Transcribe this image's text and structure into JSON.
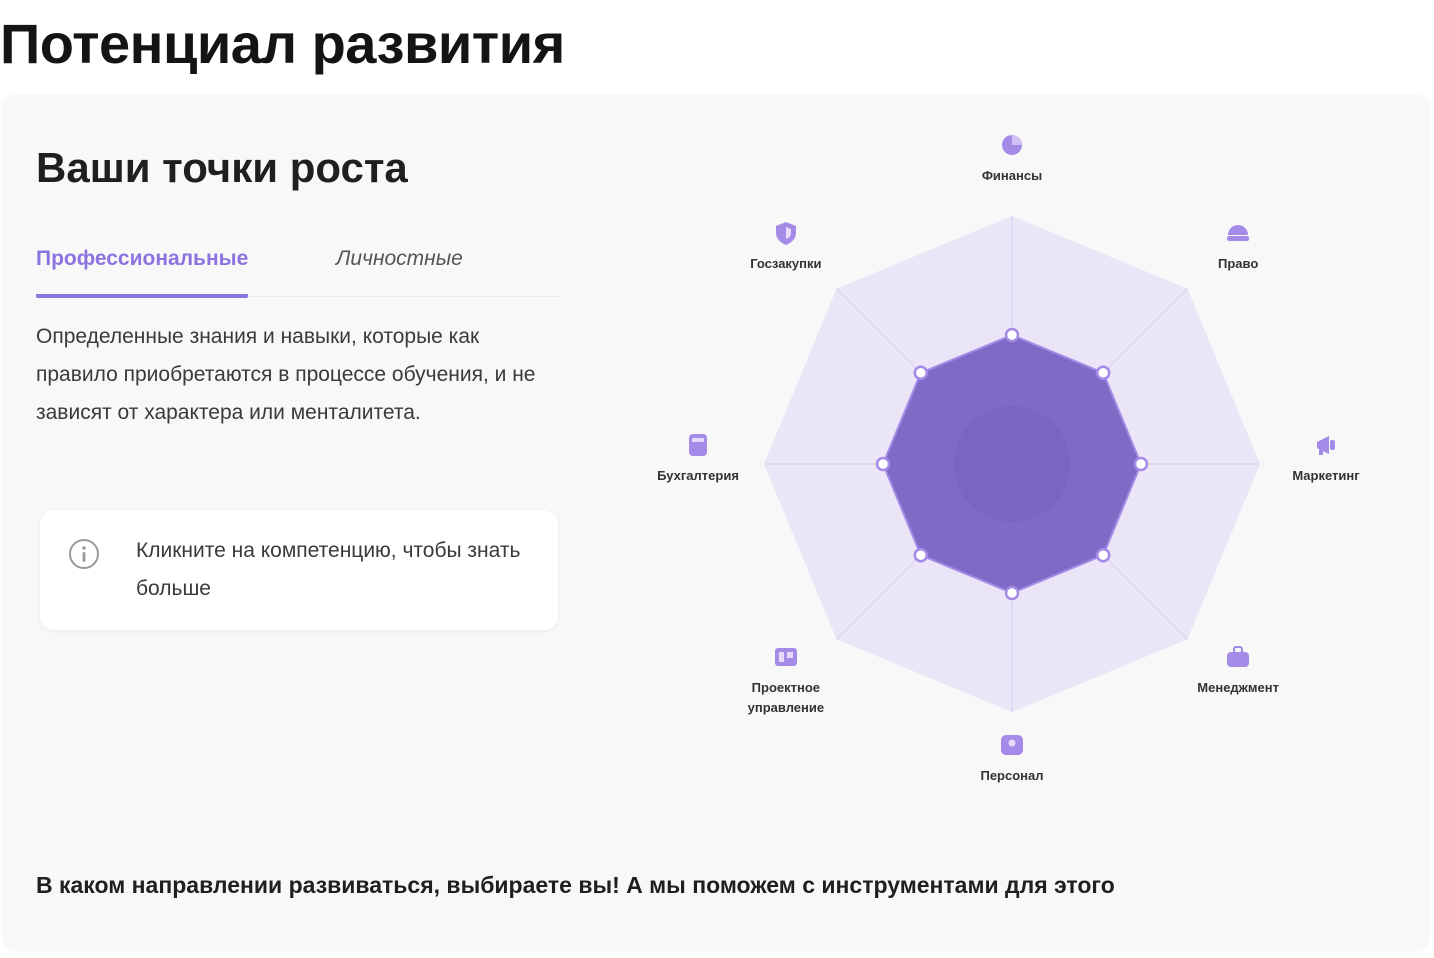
{
  "page": {
    "title": "Потенциал развития"
  },
  "card": {
    "title": "Ваши точки роста",
    "tabs": [
      {
        "label": "Профессиональные",
        "active": true
      },
      {
        "label": "Личностные",
        "active": false
      }
    ],
    "description": "Определенные знания и навыки, которые как правило приобретаются в процессе обучения, и не зависят от характера или менталитета.",
    "hint": {
      "icon": "info-icon",
      "text": "Кликните на компетенцию, чтобы знать больше"
    },
    "footer": "В каком направлении развиваться, выбираете вы! А мы поможем с инструментами для этого"
  },
  "radar": {
    "colors": {
      "outer_fill": "#ebe5f8",
      "inner_fill": "#7f6bc6",
      "accent": "#a58be8",
      "icon": "#a58be8"
    },
    "scale_max": 1,
    "axes": [
      {
        "label": "Финансы",
        "icon": "pie-chart-icon",
        "value": 0.52
      },
      {
        "label": "Право",
        "icon": "scales-icon",
        "value": 0.52
      },
      {
        "label": "Маркетинг",
        "icon": "megaphone-icon",
        "value": 0.52
      },
      {
        "label": "Менеджмент",
        "icon": "briefcase-icon",
        "value": 0.52
      },
      {
        "label": "Персонал",
        "icon": "people-icon",
        "value": 0.52
      },
      {
        "label": "Проектное управление",
        "icon": "project-board-icon",
        "value": 0.52
      },
      {
        "label": "Бухгалтерия",
        "icon": "calculator-icon",
        "value": 0.52
      },
      {
        "label": "Госзакупки",
        "icon": "shield-icon",
        "value": 0.52
      }
    ]
  }
}
